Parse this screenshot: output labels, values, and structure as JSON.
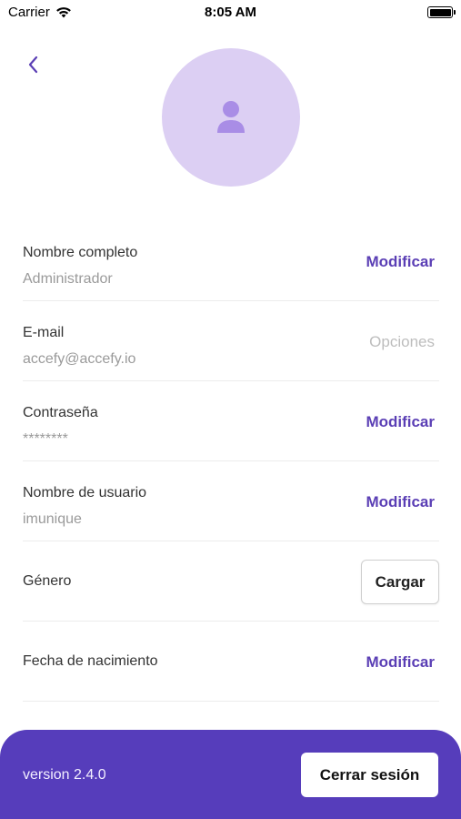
{
  "status_bar": {
    "carrier": "Carrier",
    "time": "8:05 AM",
    "battery_level": 1.0
  },
  "header": {
    "back_icon": "chevron-left-icon",
    "avatar_icon": "person-icon",
    "avatar_color": "#dccff3"
  },
  "rows": [
    {
      "label": "Nombre completo",
      "value": "Administrador",
      "action": "Modificar"
    },
    {
      "label": "E-mail",
      "value": "accefy@accefy.io",
      "action": "Opciones"
    },
    {
      "label": "Contraseña",
      "value": "********",
      "action": "Modificar"
    },
    {
      "label": "Nombre de usuario",
      "value": "imunique",
      "action": "Modificar"
    },
    {
      "label": "Género",
      "action": "Cargar"
    },
    {
      "label": "Fecha de nacimiento",
      "action": "Modificar"
    }
  ],
  "footer": {
    "version": "version 2.4.0",
    "logout_label": "Cerrar sesión",
    "background": "#563dbb"
  },
  "colors": {
    "accent": "#5b3fb5",
    "disabled": "#bdbdbd",
    "secondary_text": "#9a9a9a"
  }
}
